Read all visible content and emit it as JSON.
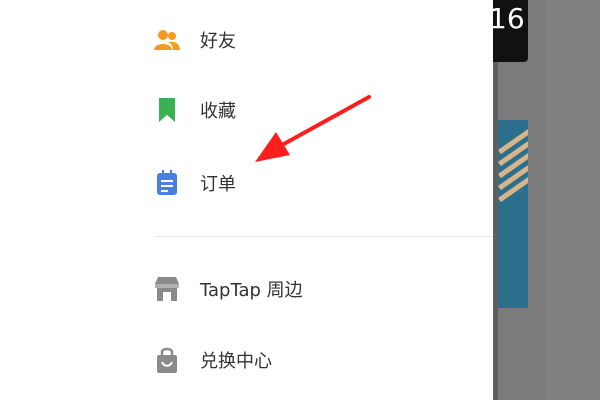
{
  "menu": {
    "items": [
      {
        "label": "好友",
        "icon": "friends-icon",
        "color": "#f59a23"
      },
      {
        "label": "收藏",
        "icon": "bookmark-icon",
        "color": "#3cb055"
      },
      {
        "label": "订单",
        "icon": "order-icon",
        "color": "#4a7fe0"
      },
      {
        "label": "TapTap 周边",
        "icon": "shop-icon",
        "color": "#8a8a8a"
      },
      {
        "label": "兑换中心",
        "icon": "shopping-bag-icon",
        "color": "#8a8a8a"
      }
    ]
  },
  "backdrop": {
    "top_text": "16",
    "color": "#7b7b7b"
  },
  "annotation": {
    "arrow_color": "#ff1e1e",
    "points_to": "订单"
  }
}
